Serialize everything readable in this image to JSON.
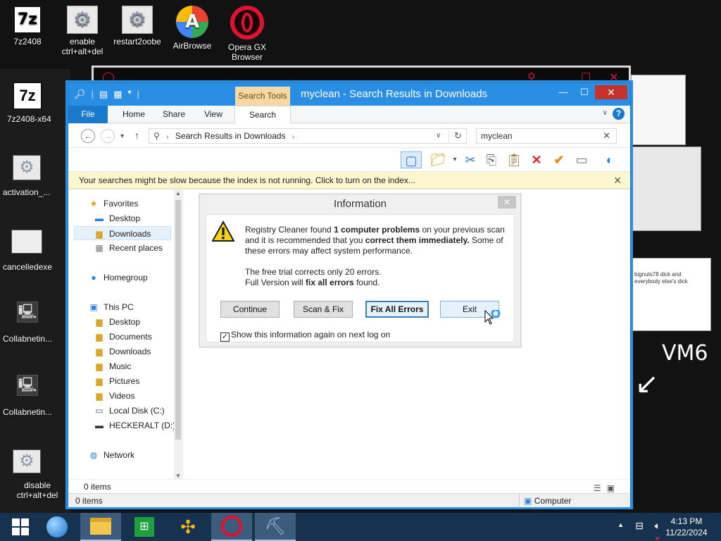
{
  "desktop": {
    "icons": [
      {
        "label": "7z2408"
      },
      {
        "label": "enable ctrl+alt+del"
      },
      {
        "label": "restart2oobe"
      },
      {
        "label": "AirBrowse"
      },
      {
        "label": "Opera GX Browser"
      }
    ],
    "left_labels": [
      "7z2408-x64",
      "activation_...",
      "cancelledexe",
      "Collabnetin...",
      "Collabnetin...",
      "disable ctrl+alt+del"
    ],
    "right_note": "bignuts78 dick and everybody else's dick",
    "right_scribble": "VM6"
  },
  "explorer": {
    "title": "myclean - Search Results in Downloads",
    "contextual_tab": "Search Tools",
    "tabs": [
      "File",
      "Home",
      "Share",
      "View",
      "Search"
    ],
    "address": "Search Results in Downloads",
    "search_value": "myclean",
    "infobar": "Your searches might be slow because the index is not running.  Click to turn on the index...",
    "nav": {
      "favorites": "Favorites",
      "favorites_items": [
        "Desktop",
        "Downloads",
        "Recent places"
      ],
      "homegroup": "Homegroup",
      "this_pc": "This PC",
      "pc_items": [
        "Desktop",
        "Documents",
        "Downloads",
        "Music",
        "Pictures",
        "Videos",
        "Local Disk (C:)",
        "HECKERALT (D:)"
      ],
      "network": "Network"
    },
    "items_count": "0 items",
    "status_left": "0 items",
    "status_right": "Computer"
  },
  "dialog": {
    "title": "Information",
    "line1_pre": "Registry Cleaner found ",
    "line1_bold": "1 computer problems",
    "line1_post": " on your previous scan and it is recommended that you ",
    "line1_bold2": "correct them immediately.",
    "line1_tail": " Some of these errors may affect system performance.",
    "line2": "The free trial corrects only 20 errors.",
    "line3_pre": "Full Version will ",
    "line3_bold": "fix all errors",
    "line3_post": " found.",
    "buttons": {
      "continue": "Continue",
      "scan_fix": "Scan & Fix",
      "fix_all": "Fix All Errors",
      "exit": "Exit"
    },
    "checkbox_label": "Show this information again on next log on",
    "checkbox_checked": true
  },
  "taskbar": {
    "time": "4:13 PM",
    "date": "11/22/2024"
  },
  "colors": {
    "accent": "#2a8ee5",
    "taskbar": "#16324f",
    "close_red": "#c7312b",
    "infobar": "#fcf7cf"
  }
}
